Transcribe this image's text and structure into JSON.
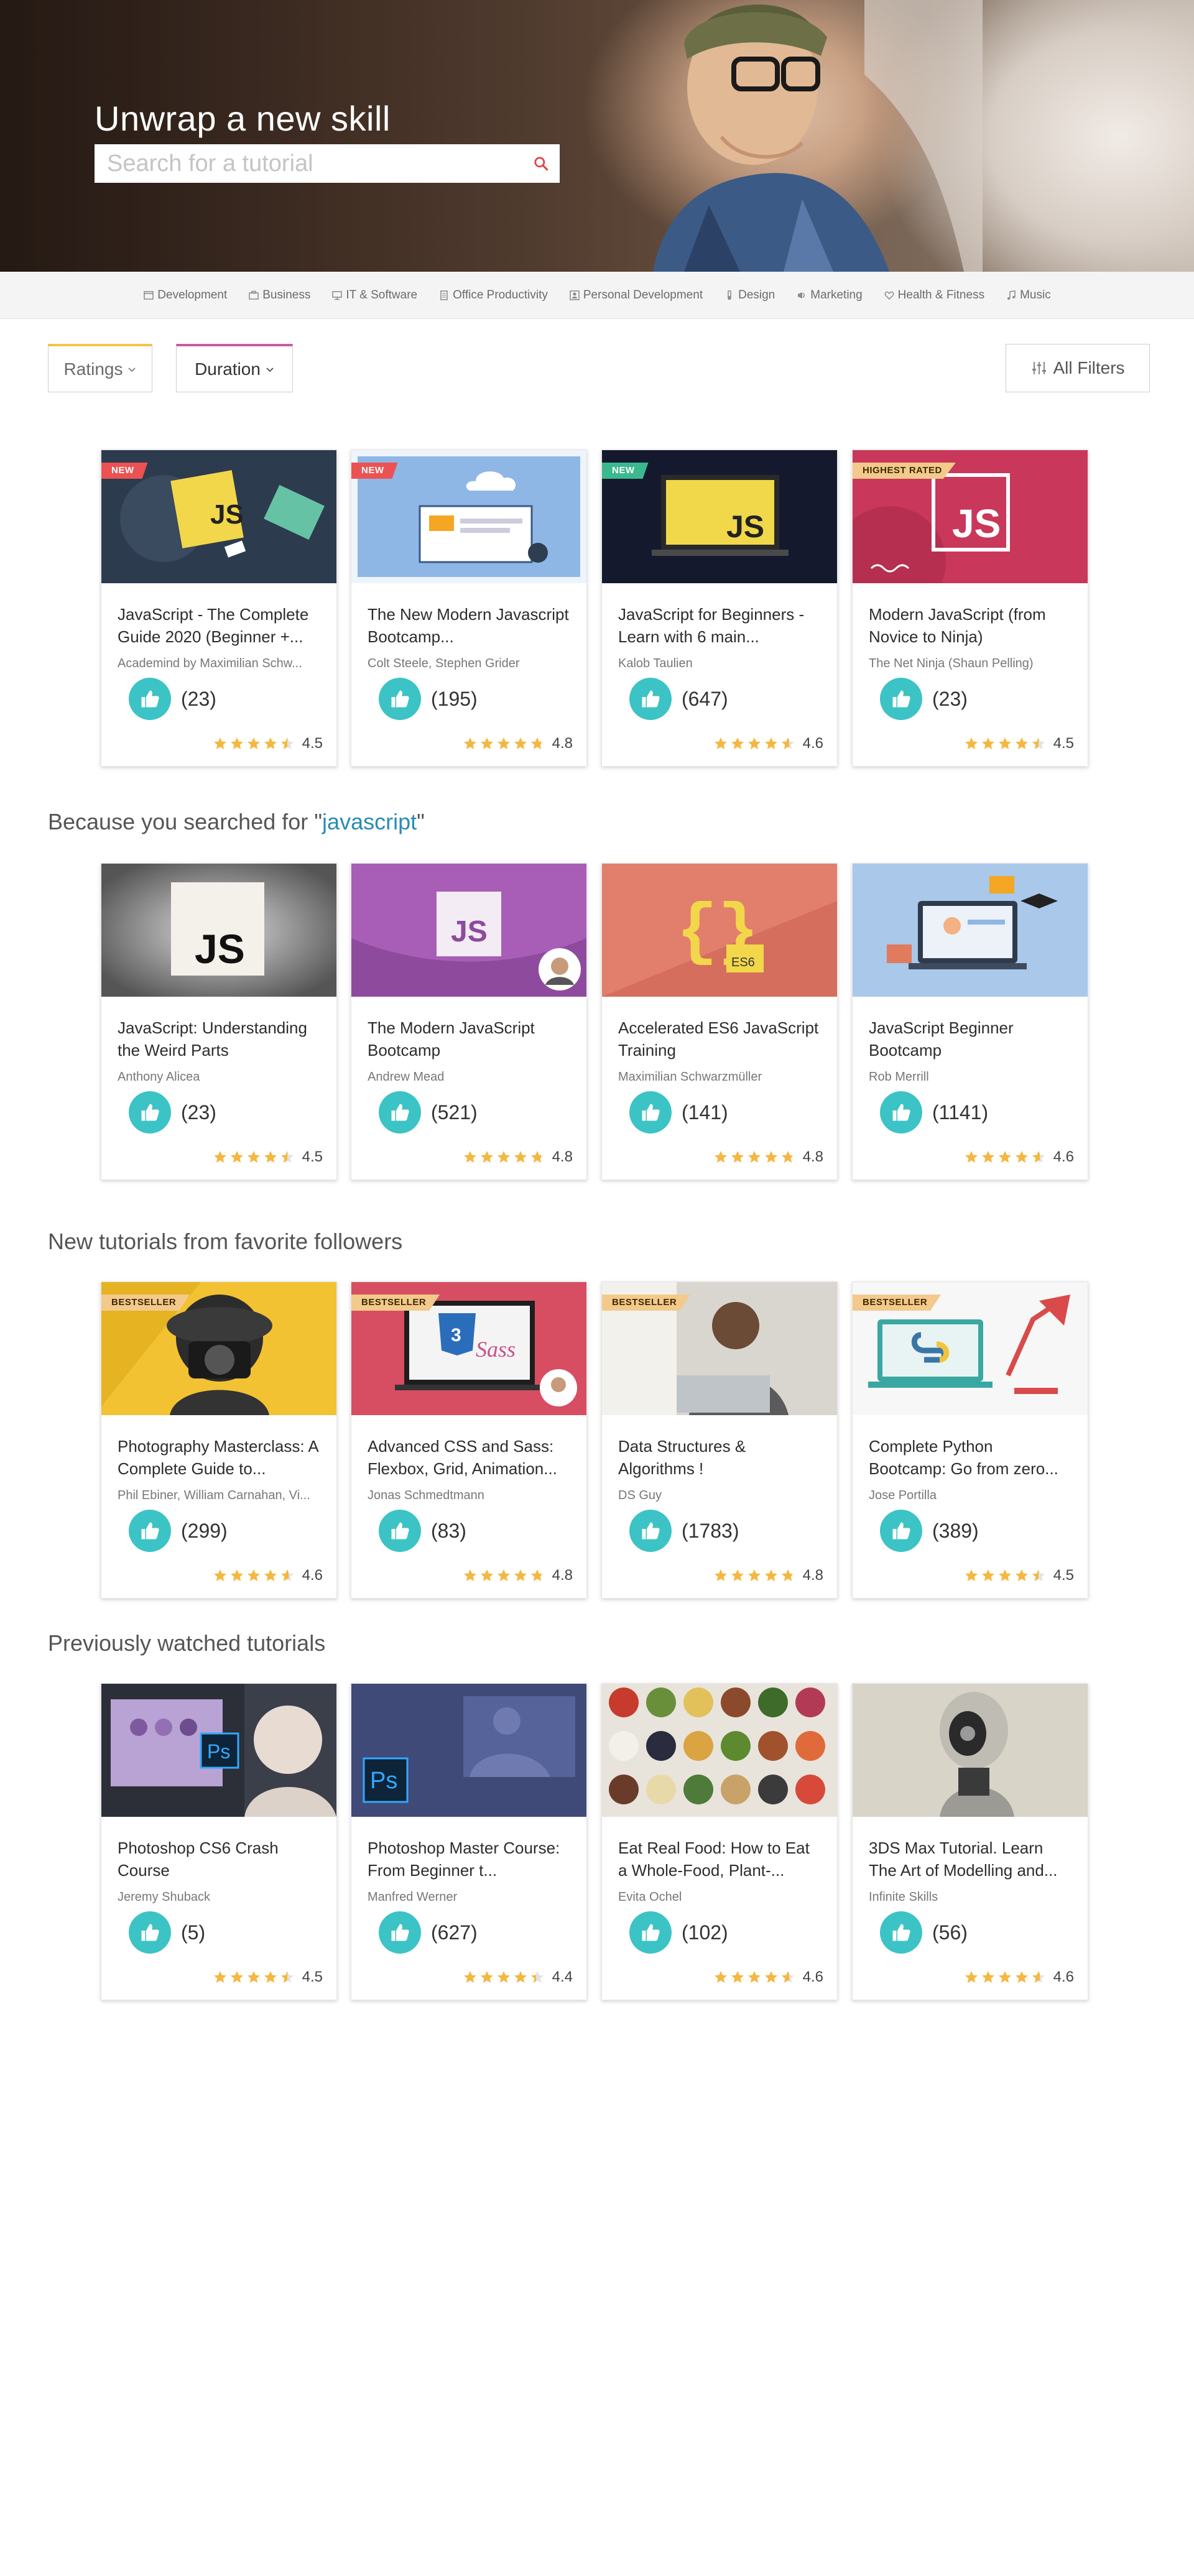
{
  "hero": {
    "title": "Unwrap a new skill",
    "search_placeholder": "Search for a tutorial"
  },
  "categories": [
    {
      "label": "Development",
      "icon": "code-icon"
    },
    {
      "label": "Business",
      "icon": "briefcase-icon"
    },
    {
      "label": "IT & Software",
      "icon": "monitor-icon"
    },
    {
      "label": "Office Productivity",
      "icon": "document-icon"
    },
    {
      "label": "Personal Development",
      "icon": "person-icon"
    },
    {
      "label": "Design",
      "icon": "brush-icon"
    },
    {
      "label": "Marketing",
      "icon": "megaphone-icon"
    },
    {
      "label": "Health & Fitness",
      "icon": "heart-icon"
    },
    {
      "label": "Music",
      "icon": "music-note-icon"
    }
  ],
  "filters": {
    "ratings": "Ratings",
    "duration": "Duration",
    "all": "All Filters"
  },
  "colors": {
    "accent_teal": "#3cc3c6",
    "star": "#f4b73f",
    "new_badge": "#ec5252",
    "bestseller_badge": "#f3ca8c",
    "keyword": "#2a8bb5"
  },
  "sections": [
    {
      "title": "",
      "courses": [
        {
          "title": "JavaScript - The Complete Guide 2020 (Beginner +...",
          "author": "Academind by Maximilian Schw...",
          "likes": "(23)",
          "rating": "4.5",
          "rating_value": 4.5,
          "badge": "NEW"
        },
        {
          "title": "The New Modern Javascript Bootcamp...",
          "author": "Colt Steele, Stephen Grider",
          "likes": "(195)",
          "rating": "4.8",
          "rating_value": 4.8,
          "badge": "NEW"
        },
        {
          "title": "JavaScript for Beginners - Learn with 6 main...",
          "author": "Kalob Taulien",
          "likes": "(647)",
          "rating": "4.6",
          "rating_value": 4.6,
          "badge": "NEW"
        },
        {
          "title": "Modern JavaScript (from Novice to Ninja)",
          "author": "The Net Ninja (Shaun Pelling)",
          "likes": "(23)",
          "rating": "4.5",
          "rating_value": 4.5,
          "badge": "HIGHEST RATED"
        }
      ]
    },
    {
      "title_prefix": "Because you searched for \"",
      "keyword": "javascript",
      "title_suffix": "\"",
      "courses": [
        {
          "title": "JavaScript: Understanding the Weird Parts",
          "author": "Anthony Alicea",
          "likes": "(23)",
          "rating": "4.5",
          "rating_value": 4.5,
          "badge": ""
        },
        {
          "title": "The Modern JavaScript Bootcamp",
          "author": "Andrew Mead",
          "likes": "(521)",
          "rating": "4.8",
          "rating_value": 4.8,
          "badge": ""
        },
        {
          "title": "Accelerated ES6 JavaScript Training",
          "author": "Maximilian Schwarzmüller",
          "likes": "(141)",
          "rating": "4.8",
          "rating_value": 4.8,
          "badge": ""
        },
        {
          "title": "JavaScript Beginner Bootcamp",
          "author": "Rob Merrill",
          "likes": "(1141)",
          "rating": "4.6",
          "rating_value": 4.6,
          "badge": ""
        }
      ]
    },
    {
      "title": "New tutorials from favorite followers",
      "courses": [
        {
          "title": "Photography Masterclass: A Complete Guide to...",
          "author": "Phil Ebiner, William Carnahan, Vi...",
          "likes": "(299)",
          "rating": "4.6",
          "rating_value": 4.6,
          "badge": "BESTSELLER"
        },
        {
          "title": "Advanced CSS and Sass: Flexbox, Grid, Animation...",
          "author": "Jonas Schmedtmann",
          "likes": "(83)",
          "rating": "4.8",
          "rating_value": 4.8,
          "badge": "BESTSELLER"
        },
        {
          "title": "Data Structures & Algorithms !",
          "author": "DS Guy",
          "likes": "(1783)",
          "rating": "4.8",
          "rating_value": 4.8,
          "badge": "BESTSELLER"
        },
        {
          "title": "Complete Python Bootcamp: Go from zero...",
          "author": "Jose Portilla",
          "likes": "(389)",
          "rating": "4.5",
          "rating_value": 4.5,
          "badge": "BESTSELLER"
        }
      ]
    },
    {
      "title": "Previously watched tutorials",
      "courses": [
        {
          "title": "Photoshop CS6 Crash Course",
          "author": "Jeremy Shuback",
          "likes": "(5)",
          "rating": "4.5",
          "rating_value": 4.5,
          "badge": ""
        },
        {
          "title": "Photoshop Master Course: From Beginner t...",
          "author": "Manfred Werner",
          "likes": "(627)",
          "rating": "4.4",
          "rating_value": 4.4,
          "badge": ""
        },
        {
          "title": "Eat Real Food: How to Eat a Whole-Food, Plant-...",
          "author": "Evita Ochel",
          "likes": "(102)",
          "rating": "4.6",
          "rating_value": 4.6,
          "badge": ""
        },
        {
          "title": "3DS Max Tutorial. Learn The Art of Modelling and...",
          "author": "Infinite Skills",
          "likes": "(56)",
          "rating": "4.6",
          "rating_value": 4.6,
          "badge": ""
        }
      ]
    }
  ]
}
